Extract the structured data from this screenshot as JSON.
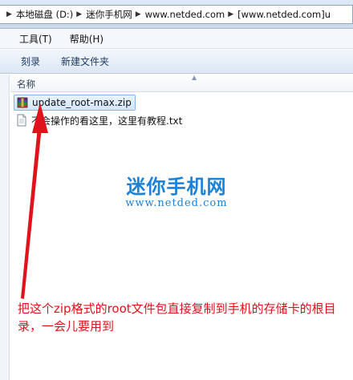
{
  "address_bar": {
    "crumbs": [
      "本地磁盘 (D:)",
      "迷你手机网",
      "www.netded.com",
      "[www.netded.com]u"
    ]
  },
  "menu": {
    "items": [
      "工具(T)",
      "帮助(H)"
    ]
  },
  "toolbar": {
    "burn_label": "刻录",
    "new_folder_label": "新建文件夹"
  },
  "list": {
    "column_name": "名称",
    "files": [
      {
        "name": "update_root-max.zip",
        "icon": "winrar-archive-icon",
        "selected": true
      },
      {
        "name": "不会操作的看这里，这里有教程.txt",
        "icon": "text-document-icon",
        "selected": false
      }
    ]
  },
  "watermark": {
    "title": "迷你手机网",
    "url": "www.netded.com"
  },
  "annotation": {
    "text": "把这个zip格式的root文件包直接复制到手机的存储卡的根目录，一会儿要用到"
  },
  "colors": {
    "annotation": "#e0121c",
    "watermark": "#1a82d8",
    "selection": "#d4e6fb"
  }
}
